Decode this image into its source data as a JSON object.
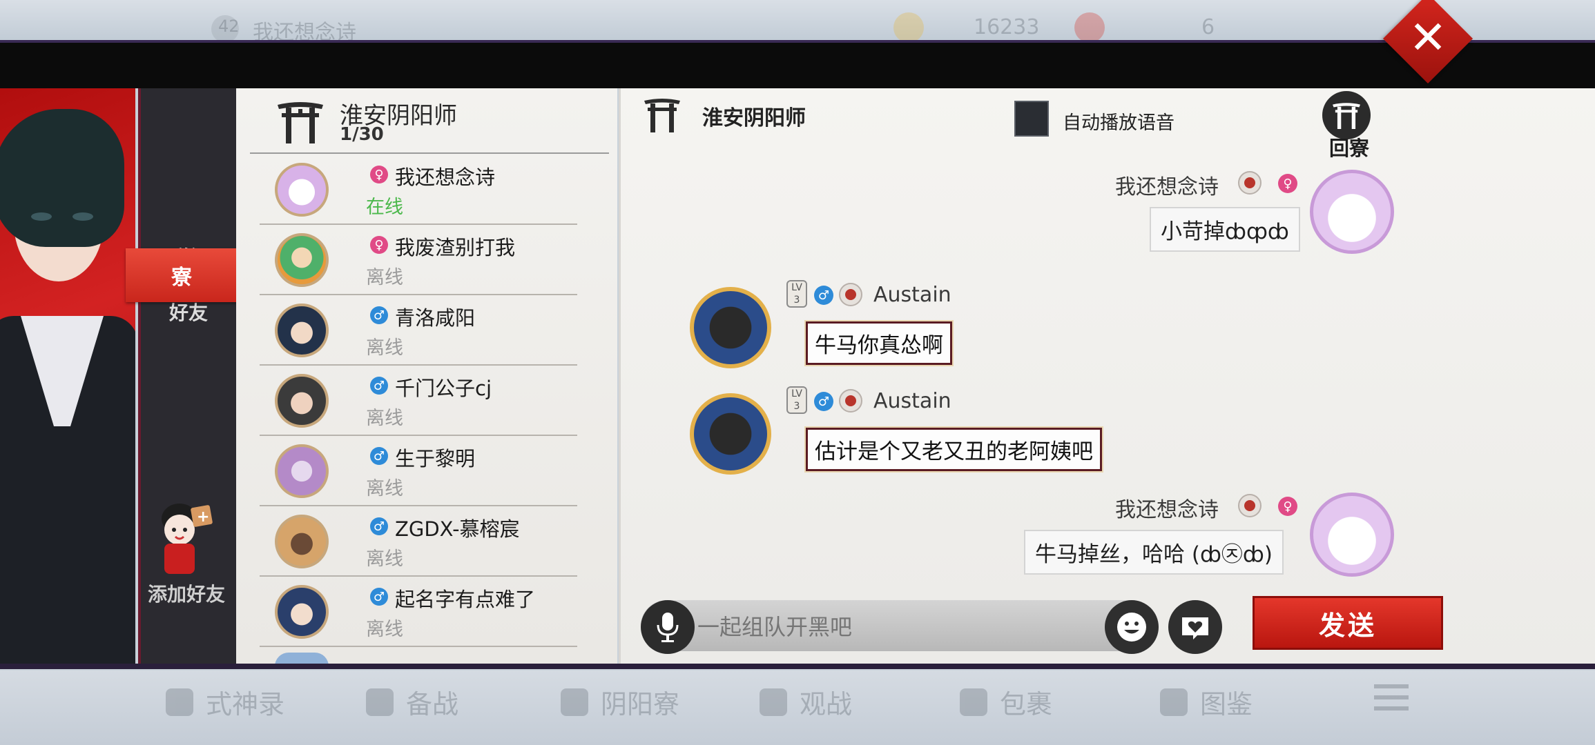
{
  "background_hud": {
    "level": "42",
    "player_name": "我还想念诗",
    "coins": "16233",
    "jade": "6",
    "bottom_nav": [
      "式神录",
      "备战",
      "阴阳寮",
      "观战",
      "包裹",
      "图鉴"
    ]
  },
  "tabs": {
    "group": "群组",
    "friends": "好友",
    "ryo": "寮"
  },
  "add_friend": {
    "label": "添加好友"
  },
  "list": {
    "title": "淮安阴阳师",
    "count": "1/30",
    "friends": [
      {
        "name": "我还想念诗",
        "status": "在线",
        "gender": "female",
        "gender_symbol": "♀"
      },
      {
        "name": "我废渣别打我",
        "status": "离线",
        "gender": "female",
        "gender_symbol": "♀"
      },
      {
        "name": "青洛咸阳",
        "status": "离线",
        "gender": "male",
        "gender_symbol": "♂"
      },
      {
        "name": "千门公子cj",
        "status": "离线",
        "gender": "male",
        "gender_symbol": "♂"
      },
      {
        "name": "生于黎明",
        "status": "离线",
        "gender": "male",
        "gender_symbol": "♂"
      },
      {
        "name": "ZGDX-慕榕宸",
        "status": "离线",
        "gender": "male",
        "gender_symbol": "♂"
      },
      {
        "name": "起名字有点难了",
        "status": "离线",
        "gender": "male",
        "gender_symbol": "♂"
      }
    ]
  },
  "chat": {
    "title": "淮安阴阳师",
    "auto_voice_label": "自动播放语音",
    "back_ryo_label": "回寮",
    "messages": [
      {
        "sender": "我还想念诗",
        "text": "小苛掉ȸȹȸ",
        "side": "self",
        "gender_symbol": "♀"
      },
      {
        "sender": "Austain",
        "level": "3",
        "text": "牛马你真怂啊",
        "side": "other",
        "gender_symbol": "♂"
      },
      {
        "sender": "Austain",
        "level": "3",
        "text": "估计是个又老又丑的老阿姨吧",
        "side": "other",
        "gender_symbol": "♂"
      },
      {
        "sender": "我还想念诗",
        "text": "牛马掉丝，哈哈 (ȸ㉨ȸ)",
        "side": "self",
        "gender_symbol": "♀"
      }
    ],
    "input_placeholder": "一起组队开黑吧",
    "send_label": "发送"
  },
  "colors": {
    "accent_red": "#d32a20",
    "online_green": "#4bb84b",
    "offline_gray": "#9b9b9b",
    "female_pink": "#e04a86",
    "male_blue": "#2e8bd8"
  },
  "icons": {
    "close": "close-icon",
    "mic": "microphone-icon",
    "emoji": "emoji-icon",
    "gift": "gift-icon",
    "torii": "torii-icon"
  }
}
